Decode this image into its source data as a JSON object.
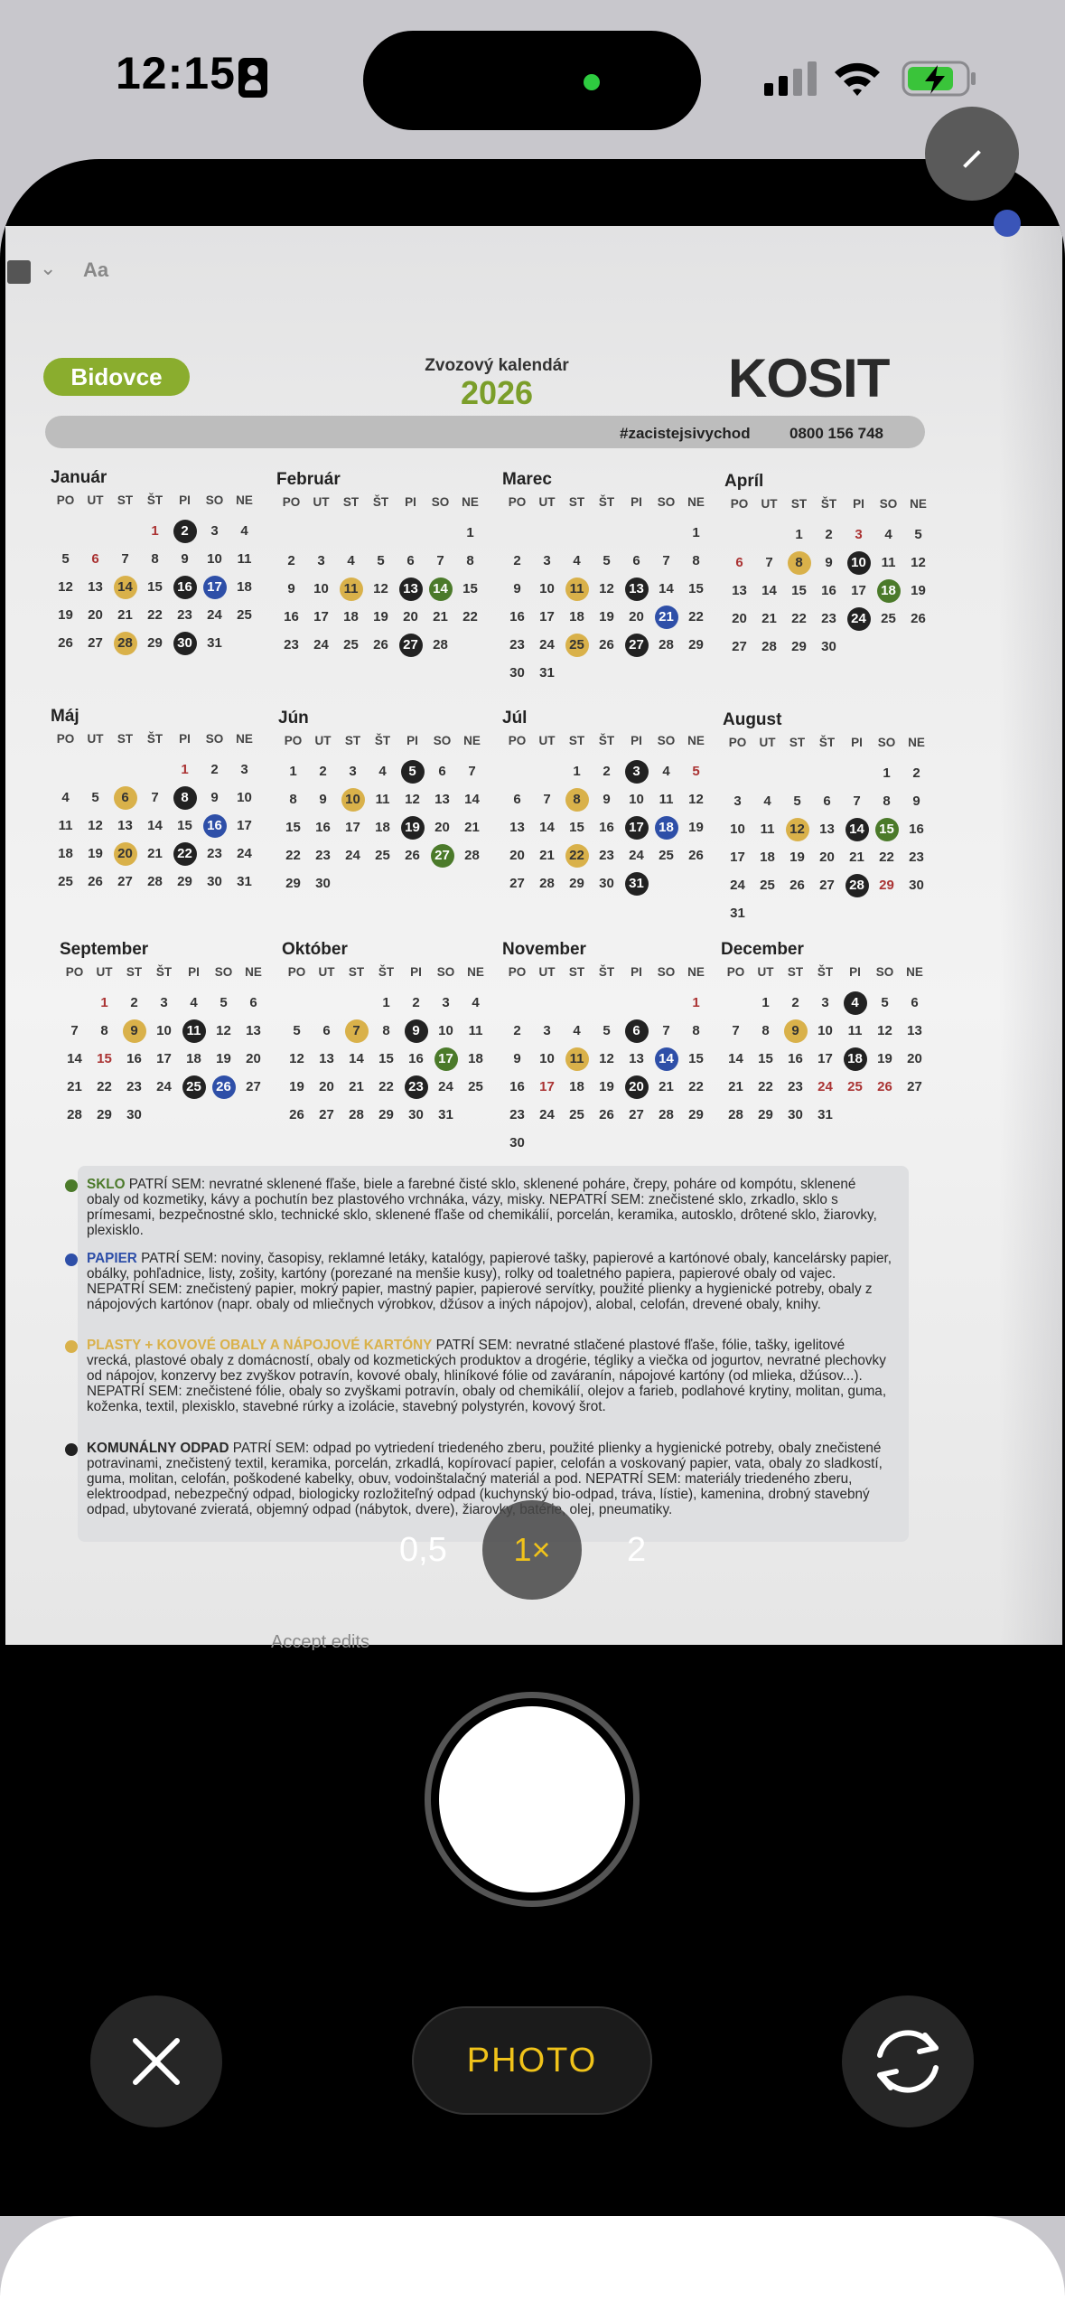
{
  "status_bar": {
    "time": "12:15"
  },
  "doc_toolbar": {
    "font_label": "Aa",
    "bottom_label": "Accept edits"
  },
  "calendar": {
    "brand_left": "Bidovce",
    "title": "Zvozový kalendár",
    "year": "2026",
    "logo": "KOSIT",
    "hashtag": "#zacistejsivychod",
    "phone": "0800 156 748",
    "weekdays": [
      "PO",
      "UT",
      "ST",
      "ŠT",
      "PI",
      "SO",
      "NE"
    ],
    "months": [
      {
        "name": "Január",
        "weeks": [
          [
            "",
            "",
            "",
            "1",
            "2",
            "3",
            "4"
          ],
          [
            "5",
            "6",
            "7",
            "8",
            "9",
            "10",
            "11"
          ],
          [
            "12",
            "13",
            "14",
            "15",
            "16",
            "17",
            "18"
          ],
          [
            "19",
            "20",
            "21",
            "22",
            "23",
            "24",
            "25"
          ],
          [
            "26",
            "27",
            "28",
            "29",
            "30",
            "31",
            ""
          ]
        ],
        "marks": {
          "1": "red",
          "2": "black",
          "6": "red",
          "14": "yellow",
          "16": "black",
          "17": "blue",
          "28": "yellow",
          "30": "black"
        }
      },
      {
        "name": "Február",
        "weeks": [
          [
            "",
            "",
            "",
            "",
            "",
            "",
            "1"
          ],
          [
            "2",
            "3",
            "4",
            "5",
            "6",
            "7",
            "8"
          ],
          [
            "9",
            "10",
            "11",
            "12",
            "13",
            "14",
            "15"
          ],
          [
            "16",
            "17",
            "18",
            "19",
            "20",
            "21",
            "22"
          ],
          [
            "23",
            "24",
            "25",
            "26",
            "27",
            "28",
            ""
          ]
        ],
        "marks": {
          "11": "yellow",
          "13": "black",
          "14": "green",
          "27": "black"
        }
      },
      {
        "name": "Marec",
        "weeks": [
          [
            "",
            "",
            "",
            "",
            "",
            "",
            "1"
          ],
          [
            "2",
            "3",
            "4",
            "5",
            "6",
            "7",
            "8"
          ],
          [
            "9",
            "10",
            "11",
            "12",
            "13",
            "14",
            "15"
          ],
          [
            "16",
            "17",
            "18",
            "19",
            "20",
            "21",
            "22"
          ],
          [
            "23",
            "24",
            "25",
            "26",
            "27",
            "28",
            "29"
          ],
          [
            "30",
            "31",
            "",
            "",
            "",
            "",
            ""
          ]
        ],
        "marks": {
          "11": "yellow",
          "13": "black",
          "21": "blue",
          "25": "yellow",
          "27": "black"
        }
      },
      {
        "name": "Apríl",
        "weeks": [
          [
            "",
            "",
            "1",
            "2",
            "3",
            "4",
            "5"
          ],
          [
            "6",
            "7",
            "8",
            "9",
            "10",
            "11",
            "12"
          ],
          [
            "13",
            "14",
            "15",
            "16",
            "17",
            "18",
            "19"
          ],
          [
            "20",
            "21",
            "22",
            "23",
            "24",
            "25",
            "26"
          ],
          [
            "27",
            "28",
            "29",
            "30",
            "",
            "",
            ""
          ]
        ],
        "marks": {
          "3": "red",
          "6": "red",
          "8": "yellow",
          "10": "black",
          "18": "green",
          "24": "black"
        }
      },
      {
        "name": "Máj",
        "weeks": [
          [
            "",
            "",
            "",
            "",
            "1",
            "2",
            "3"
          ],
          [
            "4",
            "5",
            "6",
            "7",
            "8",
            "9",
            "10"
          ],
          [
            "11",
            "12",
            "13",
            "14",
            "15",
            "16",
            "17"
          ],
          [
            "18",
            "19",
            "20",
            "21",
            "22",
            "23",
            "24"
          ],
          [
            "25",
            "26",
            "27",
            "28",
            "29",
            "30",
            "31"
          ]
        ],
        "marks": {
          "1": "red",
          "6": "yellow",
          "8": "black",
          "16": "blue",
          "20": "yellow",
          "22": "black"
        }
      },
      {
        "name": "Jún",
        "weeks": [
          [
            "1",
            "2",
            "3",
            "4",
            "5",
            "6",
            "7"
          ],
          [
            "8",
            "9",
            "10",
            "11",
            "12",
            "13",
            "14"
          ],
          [
            "15",
            "16",
            "17",
            "18",
            "19",
            "20",
            "21"
          ],
          [
            "22",
            "23",
            "24",
            "25",
            "26",
            "27",
            "28"
          ],
          [
            "29",
            "30",
            "",
            "",
            "",
            "",
            ""
          ]
        ],
        "marks": {
          "5": "black",
          "10": "yellow",
          "19": "black",
          "27": "green"
        }
      },
      {
        "name": "Júl",
        "weeks": [
          [
            "",
            "",
            "1",
            "2",
            "3",
            "4",
            "5"
          ],
          [
            "6",
            "7",
            "8",
            "9",
            "10",
            "11",
            "12"
          ],
          [
            "13",
            "14",
            "15",
            "16",
            "17",
            "18",
            "19"
          ],
          [
            "20",
            "21",
            "22",
            "23",
            "24",
            "25",
            "26"
          ],
          [
            "27",
            "28",
            "29",
            "30",
            "31",
            "",
            ""
          ]
        ],
        "marks": {
          "3": "black",
          "5": "red",
          "8": "yellow",
          "17": "black",
          "18": "blue",
          "22": "yellow",
          "31": "black"
        }
      },
      {
        "name": "August",
        "weeks": [
          [
            "",
            "",
            "",
            "",
            "",
            "1",
            "2"
          ],
          [
            "3",
            "4",
            "5",
            "6",
            "7",
            "8",
            "9"
          ],
          [
            "10",
            "11",
            "12",
            "13",
            "14",
            "15",
            "16"
          ],
          [
            "17",
            "18",
            "19",
            "20",
            "21",
            "22",
            "23"
          ],
          [
            "24",
            "25",
            "26",
            "27",
            "28",
            "29",
            "30"
          ],
          [
            "31",
            "",
            "",
            "",
            "",
            "",
            ""
          ]
        ],
        "marks": {
          "12": "yellow",
          "14": "black",
          "15": "green",
          "28": "black",
          "29": "red"
        }
      },
      {
        "name": "September",
        "weeks": [
          [
            "",
            "1",
            "2",
            "3",
            "4",
            "5",
            "6"
          ],
          [
            "7",
            "8",
            "9",
            "10",
            "11",
            "12",
            "13"
          ],
          [
            "14",
            "15",
            "16",
            "17",
            "18",
            "19",
            "20"
          ],
          [
            "21",
            "22",
            "23",
            "24",
            "25",
            "26",
            "27"
          ],
          [
            "28",
            "29",
            "30",
            "",
            "",
            "",
            ""
          ]
        ],
        "marks": {
          "1": "red",
          "9": "yellow",
          "11": "black",
          "15": "red",
          "25": "black",
          "26": "blue"
        }
      },
      {
        "name": "Október",
        "weeks": [
          [
            "",
            "",
            "",
            "1",
            "2",
            "3",
            "4"
          ],
          [
            "5",
            "6",
            "7",
            "8",
            "9",
            "10",
            "11"
          ],
          [
            "12",
            "13",
            "14",
            "15",
            "16",
            "17",
            "18"
          ],
          [
            "19",
            "20",
            "21",
            "22",
            "23",
            "24",
            "25"
          ],
          [
            "26",
            "27",
            "28",
            "29",
            "30",
            "31",
            ""
          ]
        ],
        "marks": {
          "7": "yellow",
          "9": "black",
          "17": "green",
          "23": "black"
        }
      },
      {
        "name": "November",
        "weeks": [
          [
            "",
            "",
            "",
            "",
            "",
            "",
            "1"
          ],
          [
            "2",
            "3",
            "4",
            "5",
            "6",
            "7",
            "8"
          ],
          [
            "9",
            "10",
            "11",
            "12",
            "13",
            "14",
            "15"
          ],
          [
            "16",
            "17",
            "18",
            "19",
            "20",
            "21",
            "22"
          ],
          [
            "23",
            "24",
            "25",
            "26",
            "27",
            "28",
            "29"
          ],
          [
            "30",
            "",
            "",
            "",
            "",
            "",
            ""
          ]
        ],
        "marks": {
          "1": "red",
          "6": "black",
          "11": "yellow",
          "14": "blue",
          "17": "red",
          "20": "black"
        }
      },
      {
        "name": "December",
        "weeks": [
          [
            "",
            "1",
            "2",
            "3",
            "4",
            "5",
            "6"
          ],
          [
            "7",
            "8",
            "9",
            "10",
            "11",
            "12",
            "13"
          ],
          [
            "14",
            "15",
            "16",
            "17",
            "18",
            "19",
            "20"
          ],
          [
            "21",
            "22",
            "23",
            "24",
            "25",
            "26",
            "27"
          ],
          [
            "28",
            "29",
            "30",
            "31",
            "",
            "",
            ""
          ]
        ],
        "marks": {
          "4": "black",
          "9": "yellow",
          "18": "black",
          "24": "red",
          "25": "red",
          "26": "red"
        }
      }
    ]
  },
  "legend": [
    {
      "color": "#4b7a2a",
      "category": "SKLO",
      "text": " PATRÍ SEM: nevratné sklenené fľaše, biele a farebné čisté sklo, sklenené poháre, črepy, poháre od kompótu, sklenené obaly od kozmetiky, kávy a pochutín bez plastového vrchnáka, vázy, misky. NEPATRÍ SEM: znečistené sklo, zrkadlo, sklo s prímesami, bezpečnostné sklo, technické sklo, sklenené fľaše od chemikálií, porcelán, keramika, autosklo, drôtené sklo, žiarovky, plexisklo."
    },
    {
      "color": "#2e4fa8",
      "category": "PAPIER",
      "text": " PATRÍ SEM: noviny, časopisy, reklamné letáky, katalógy, papierové tašky, papierové a kartónové obaly, kancelársky papier, obálky, pohľadnice, listy, zošity, kartóny (porezané na menšie kusy), rolky od toaletného papiera, papierové obaly od vajec. NEPATRÍ SEM: znečistený papier, mokrý papier, mastný papier, papierové servítky, použité plienky a hygienické potreby, obaly z nápojových kartónov (napr. obaly od mliečnych výrobkov, džúsov a iných nápojov), alobal, celofán, drevené obaly, knihy."
    },
    {
      "color": "#d9b14a",
      "category": "PLASTY + KOVOVÉ OBALY A NÁPOJOVÉ KARTÓNY",
      "text": " PATRÍ SEM: nevratné stlačené plastové fľaše, fólie, tašky, igelitové vrecká, plastové obaly z domácností, obaly od kozmetických produktov a drogérie, tégliky a viečka od jogurtov, nevratné plechovky od nápojov, konzervy bez zvyškov potravín, kovové obaly, hliníkové fólie od zaváranín, nápojové kartóny (od mlieka, džúsov...). NEPATRÍ SEM: znečistené fólie, obaly so zvyškami potravín, obaly od chemikálií, olejov a farieb, podlahové krytiny, molitan, guma, koženka, textil, plexisklo, stavebné rúrky a izolácie, stavebný polystyrén, kovový šrot."
    },
    {
      "color": "#222222",
      "category": "KOMUNÁLNY ODPAD",
      "text": " PATRÍ SEM: odpad po vytriedení triedeného zberu, použité plienky a hygienické potreby, obaly znečistené potravinami, znečistený textil, keramika, porcelán, zrkadlá, kopírovací papier, celofán a voskovaný papier, vata, obaly zo sladkostí, guma, molitan, celofán, poškodené kabelky, obuv, vodoinštalačný materiál a pod. NEPATRÍ SEM: materiály triedeného zberu, elektroodpad, nebezpečný odpad, biologicky rozložiteľný odpad (kuchynský bio-odpad, tráva, lístie), kamenina, drobný stavebný odpad, ubytované zvieratá, objemný odpad (nábytok, dvere), žiarovky, batérie, olej, pneumatiky."
    }
  ],
  "camera": {
    "zoom_options": [
      "0,5",
      "1×",
      "2"
    ],
    "mode": "PHOTO"
  }
}
